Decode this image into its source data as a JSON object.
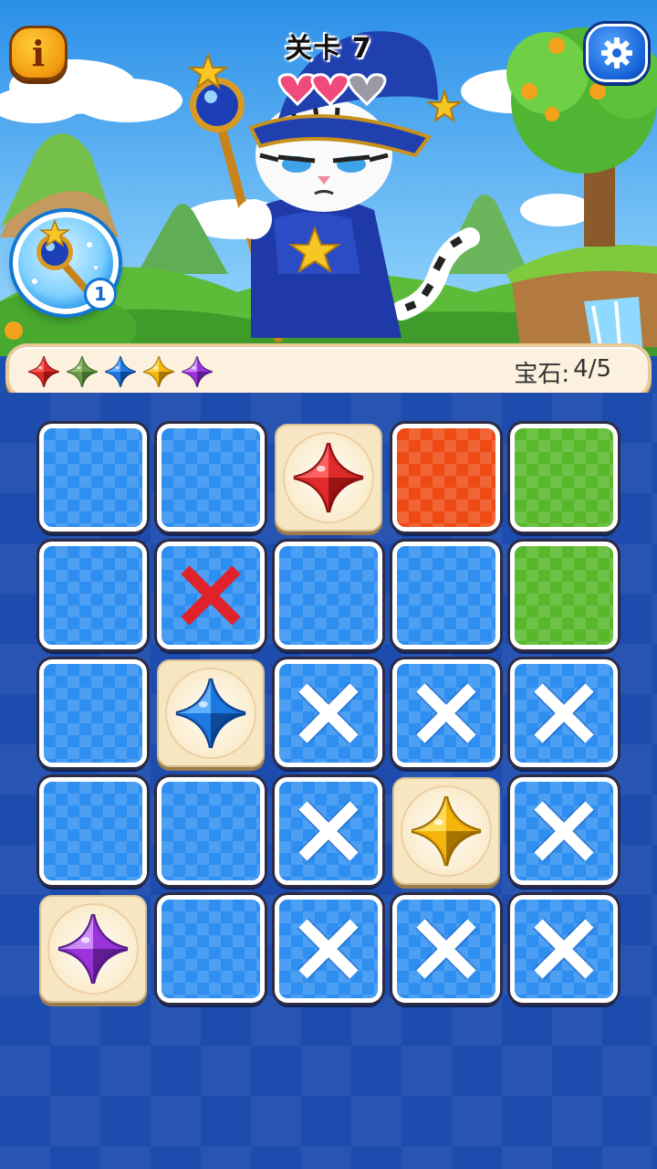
{
  "header": {
    "level_title": "关卡 7",
    "info_icon": "info-icon",
    "settings_icon": "gear-icon"
  },
  "powerup": {
    "icon": "magic-wand-icon",
    "count": "1"
  },
  "status": {
    "gem_icons": [
      {
        "color": "red",
        "hex": "#e02a2a"
      },
      {
        "color": "green",
        "hex": "#6a9a4a"
      },
      {
        "color": "blue",
        "hex": "#1f78e0"
      },
      {
        "color": "yellow",
        "hex": "#f5b50a"
      },
      {
        "color": "purple",
        "hex": "#9a34d8"
      }
    ],
    "gems_label": "宝石:",
    "gems_value": "4/5"
  },
  "board": {
    "rows": 5,
    "cols": 5,
    "cells": [
      [
        "blue",
        "blue",
        "gem-red",
        "orange",
        "green"
      ],
      [
        "blue",
        "red-x",
        "blue",
        "blue",
        "green"
      ],
      [
        "blue",
        "gem-blue",
        "blue-x",
        "blue-x",
        "blue-x"
      ],
      [
        "blue",
        "blue",
        "blue-x",
        "gem-yellow",
        "blue-x"
      ],
      [
        "gem-purple",
        "blue",
        "blue-x",
        "blue-x",
        "blue-x"
      ]
    ]
  },
  "colors": {
    "tile_blue": "#2e8ff0",
    "tile_orange": "#ee4a14",
    "tile_green": "#56b82a",
    "revealed_bg": "#f7e6c2",
    "wrong_mark": "#e0232a",
    "board_bg": "#1d4cae"
  }
}
